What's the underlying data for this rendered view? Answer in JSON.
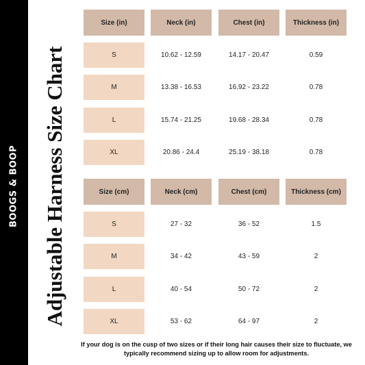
{
  "brand": "BOOGS & BOOP",
  "title": "Adjustable Harness Size Chart",
  "colors": {
    "sidebar": "#000000",
    "header_bg": "#d2b9a8",
    "size_bg": "#f2d8c2"
  },
  "inches_table": {
    "headers": [
      "Size (in)",
      "Neck (in)",
      "Chest (in)",
      "Thickness (in)"
    ],
    "rows": [
      {
        "size": "S",
        "neck": "10.62 - 12.59",
        "chest": "14.17 - 20.47",
        "thickness": "0.59"
      },
      {
        "size": "M",
        "neck": "13.38 - 16.53",
        "chest": "16.92 - 23.22",
        "thickness": "0.78"
      },
      {
        "size": "L",
        "neck": "15.74 - 21.25",
        "chest": "19.68 - 28.34",
        "thickness": "0.78"
      },
      {
        "size": "XL",
        "neck": "20.86 - 24.4",
        "chest": "25.19 - 38.18",
        "thickness": "0.78"
      }
    ]
  },
  "cm_table": {
    "headers": [
      "Size (cm)",
      "Neck (cm)",
      "Chest (cm)",
      "Thickness (cm)"
    ],
    "rows": [
      {
        "size": "S",
        "neck": "27 - 32",
        "chest": "36 - 52",
        "thickness": "1.5"
      },
      {
        "size": "M",
        "neck": "34 - 42",
        "chest": "43 - 59",
        "thickness": "2"
      },
      {
        "size": "L",
        "neck": "40 - 54",
        "chest": "50 - 72",
        "thickness": "2"
      },
      {
        "size": "XL",
        "neck": "53 - 62",
        "chest": "64 - 97",
        "thickness": "2"
      }
    ]
  },
  "note": "If your dog is on the cusp of two sizes or if their long hair causes their size to fluctuate, we typically recommend sizing up to allow room for adjustments."
}
